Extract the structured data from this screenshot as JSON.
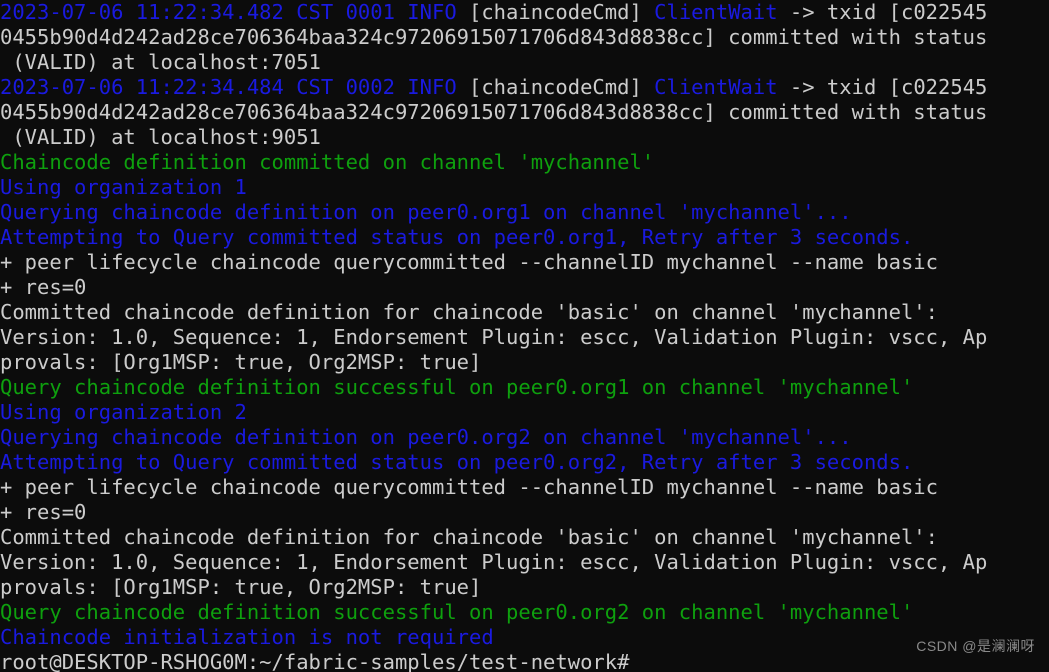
{
  "terminal": {
    "background": "#0c0c0c",
    "default_fg": "#cccccc",
    "colors": {
      "white": "#cccccc",
      "blue": "#1a1ae0",
      "green": "#0ea00e",
      "cyan": "#3a96dd"
    },
    "prompt_user_host": "root@DESKTOP-RSHOG0M",
    "prompt_path": "~/fabric-samples/test-network",
    "prompt_symbol": "#",
    "lines": [
      [
        {
          "t": "2023-07-06 11:22:34.482 CST 0001 INFO",
          "c": "blue"
        },
        {
          "t": " [chaincodeCmd] ",
          "c": "white"
        },
        {
          "t": "ClientWait",
          "c": "blue"
        },
        {
          "t": " -> txid [c022545",
          "c": "white"
        }
      ],
      [
        {
          "t": "0455b90d4d242ad28ce706364baa324c97206915071706d843d8838cc] committed with status",
          "c": "white"
        }
      ],
      [
        {
          "t": " (VALID) at localhost:7051",
          "c": "white"
        }
      ],
      [
        {
          "t": "2023-07-06 11:22:34.484 CST 0002 INFO",
          "c": "blue"
        },
        {
          "t": " [chaincodeCmd] ",
          "c": "white"
        },
        {
          "t": "ClientWait",
          "c": "blue"
        },
        {
          "t": " -> txid [c022545",
          "c": "white"
        }
      ],
      [
        {
          "t": "0455b90d4d242ad28ce706364baa324c97206915071706d843d8838cc] committed with status",
          "c": "white"
        }
      ],
      [
        {
          "t": " (VALID) at localhost:9051",
          "c": "white"
        }
      ],
      [
        {
          "t": "Chaincode definition committed on channel 'mychannel'",
          "c": "green"
        }
      ],
      [
        {
          "t": "Using organization 1",
          "c": "blue"
        }
      ],
      [
        {
          "t": "Querying chaincode definition on peer0.org1 on channel 'mychannel'...",
          "c": "blue"
        }
      ],
      [
        {
          "t": "Attempting to Query committed status on peer0.org1, Retry after 3 seconds.",
          "c": "blue"
        }
      ],
      [
        {
          "t": "+ peer lifecycle chaincode querycommitted --channelID mychannel --name basic",
          "c": "white"
        }
      ],
      [
        {
          "t": "+ res=0",
          "c": "white"
        }
      ],
      [
        {
          "t": "Committed chaincode definition for chaincode 'basic' on channel 'mychannel':",
          "c": "white"
        }
      ],
      [
        {
          "t": "Version: 1.0, Sequence: 1, Endorsement Plugin: escc, Validation Plugin: vscc, Ap",
          "c": "white"
        }
      ],
      [
        {
          "t": "provals: [Org1MSP: true, Org2MSP: true]",
          "c": "white"
        }
      ],
      [
        {
          "t": "Query chaincode definition successful on peer0.org1 on channel 'mychannel'",
          "c": "green"
        }
      ],
      [
        {
          "t": "Using organization 2",
          "c": "blue"
        }
      ],
      [
        {
          "t": "Querying chaincode definition on peer0.org2 on channel 'mychannel'...",
          "c": "blue"
        }
      ],
      [
        {
          "t": "Attempting to Query committed status on peer0.org2, Retry after 3 seconds.",
          "c": "blue"
        }
      ],
      [
        {
          "t": "+ peer lifecycle chaincode querycommitted --channelID mychannel --name basic",
          "c": "white"
        }
      ],
      [
        {
          "t": "+ res=0",
          "c": "white"
        }
      ],
      [
        {
          "t": "Committed chaincode definition for chaincode 'basic' on channel 'mychannel':",
          "c": "white"
        }
      ],
      [
        {
          "t": "Version: 1.0, Sequence: 1, Endorsement Plugin: escc, Validation Plugin: vscc, Ap",
          "c": "white"
        }
      ],
      [
        {
          "t": "provals: [Org1MSP: true, Org2MSP: true]",
          "c": "white"
        }
      ],
      [
        {
          "t": "Query chaincode definition successful on peer0.org2 on channel 'mychannel'",
          "c": "green"
        }
      ],
      [
        {
          "t": "Chaincode initialization is not required",
          "c": "blue"
        }
      ],
      [
        {
          "t": "root@DESKTOP-RSHOG0M:~/fabric-samples/test-network#",
          "c": "white"
        }
      ]
    ]
  },
  "watermark": {
    "text": "CSDN @是澜澜呀"
  }
}
